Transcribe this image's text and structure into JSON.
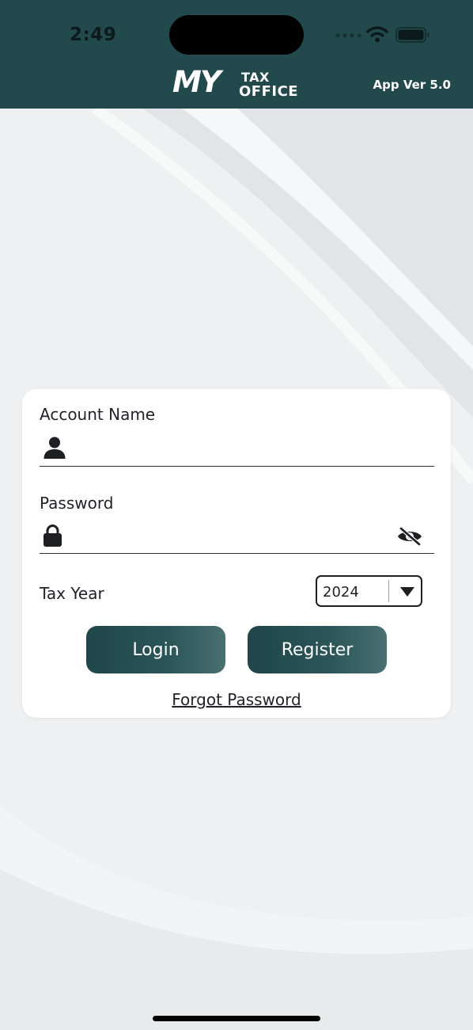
{
  "status_bar": {
    "time": "2:49"
  },
  "header": {
    "logo": {
      "my": "MY",
      "tax": "TAX",
      "office": "OFFICE"
    },
    "app_version": "App Ver 5.0",
    "background_color": "#224a4d"
  },
  "login_form": {
    "account_name": {
      "label": "Account Name",
      "value": "",
      "placeholder": "",
      "icon": "person-icon"
    },
    "password": {
      "label": "Password",
      "value": "",
      "placeholder": "",
      "icon": "lock-icon",
      "toggle_icon": "eye-slash-icon"
    },
    "tax_year": {
      "label": "Tax Year",
      "selected": "2024"
    },
    "login_label": "Login",
    "register_label": "Register",
    "forgot_password_label": "Forgot Password"
  },
  "colors": {
    "accent": "#224a4d",
    "button_gradient_start": "#1f4649",
    "button_gradient_end": "#4a7071",
    "background": "#eef0f1"
  }
}
